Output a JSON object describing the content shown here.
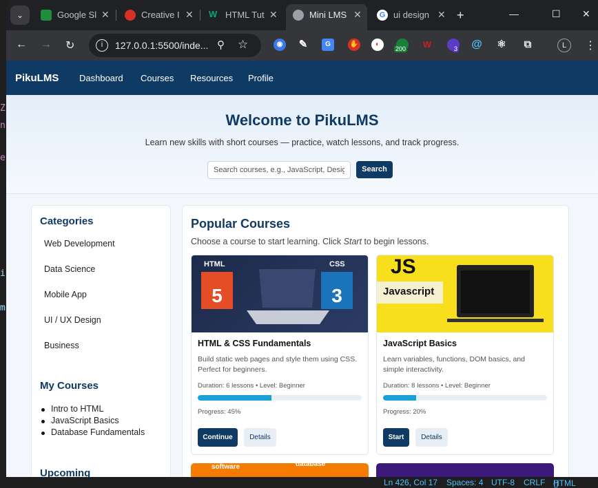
{
  "browser": {
    "tabs": [
      {
        "title": "Google Sl",
        "favicon": "google-slides-icon",
        "color": "#1e8e3e"
      },
      {
        "title": "Creative I",
        "favicon": "creative-icon",
        "color": "#d93025"
      },
      {
        "title": "HTML Tut",
        "favicon": "w3schools-icon",
        "color": "#04aa6d"
      },
      {
        "title": "Mini LMS",
        "favicon": "globe-icon",
        "color": "#9aa0a6"
      },
      {
        "title": "ui design",
        "favicon": "google-icon",
        "color": "#4285f4"
      }
    ],
    "url": "127.0.0.1:5500/inde...",
    "ext_badges": [
      "200",
      "3"
    ],
    "profile_initial": "L"
  },
  "site": {
    "brand": "PikuLMS",
    "nav": [
      "Dashboard",
      "Courses",
      "Resources",
      "Profile"
    ],
    "hero": {
      "title": "Welcome to PikuLMS",
      "subtitle": "Learn new skills with short courses — practice, watch lessons, and track progress.",
      "search_placeholder": "Search courses, e.g., JavaScript, Design",
      "search_button": "Search"
    },
    "sidebar": {
      "categories_title": "Categories",
      "categories": [
        "Web Development",
        "Data Science",
        "Mobile App",
        "UI / UX Design",
        "Business"
      ],
      "my_courses_title": "My Courses",
      "my_courses": [
        "Intro to HTML",
        "JavaScript Basics",
        "Database Fundamentals"
      ],
      "upcoming_title": "Upcoming"
    },
    "main": {
      "title": "Popular Courses",
      "subtitle_before": "Choose a course to start learning. Click ",
      "subtitle_em": "Start",
      "subtitle_after": " to begin lessons.",
      "courses": [
        {
          "title": "HTML & CSS Fundamentals",
          "description": "Build static web pages and style them using CSS. Perfect for beginners.",
          "meta": "Duration: 6 lessons • Level: Beginner",
          "progress_value": 0.45,
          "progress_text": "Progress: 45%",
          "primary_label": "Continue",
          "secondary_label": "Details",
          "image_labels": [
            "HTML",
            "CSS"
          ]
        },
        {
          "title": "JavaScript Basics",
          "description": "Learn variables, functions, DOM basics, and simple interactivity.",
          "meta": "Duration: 8 lessons • Level: Beginner",
          "progress_value": 0.2,
          "progress_text": "Progress: 20%",
          "primary_label": "Start",
          "secondary_label": "Details",
          "image_labels": [
            "JS",
            "Javascript"
          ]
        }
      ],
      "peek_labels": [
        "software",
        "database"
      ]
    }
  },
  "statusbar": {
    "position": "Ln 426, Col 17",
    "spaces": "Spaces: 4",
    "encoding": "UTF-8",
    "eol": "CRLF",
    "language": "HTML"
  }
}
